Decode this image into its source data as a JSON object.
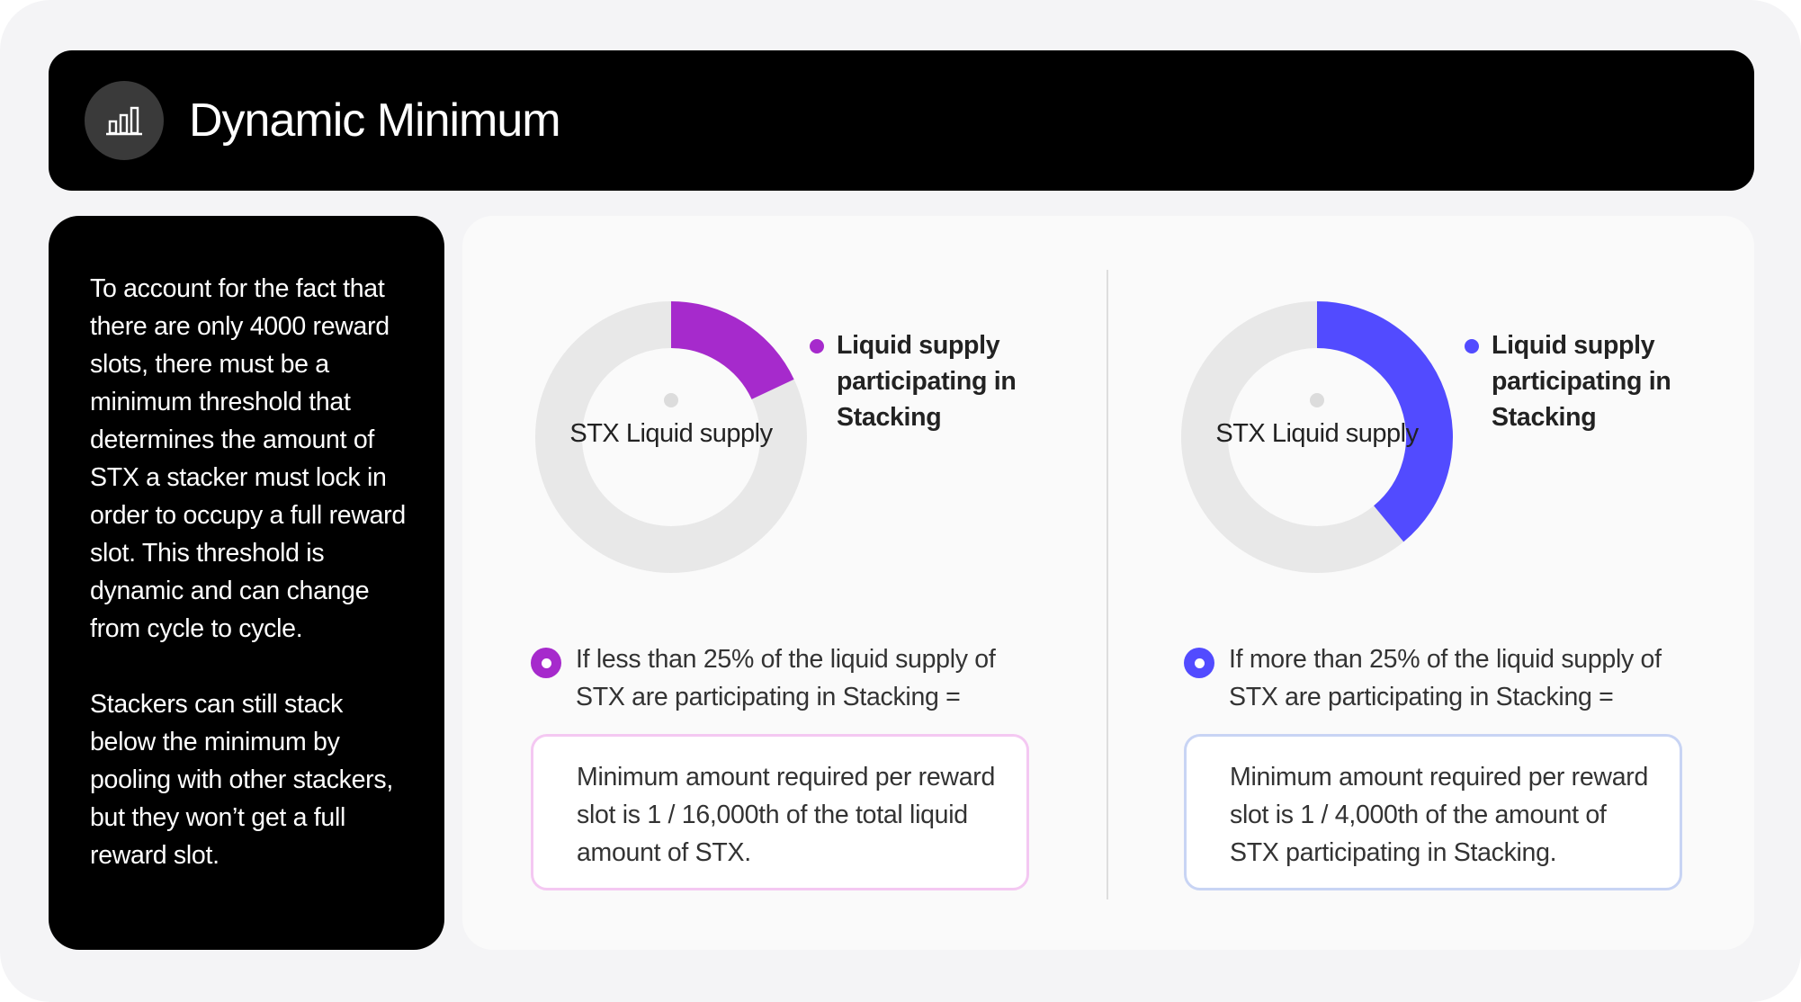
{
  "header": {
    "title": "Dynamic Minimum",
    "icon": "bar-chart-icon"
  },
  "sidebar": {
    "paragraphs": [
      "To account for the fact that there are only 4000 reward slots, there must be a minimum threshold that determines the amount of STX a stacker must lock in order to occupy a full reward slot. This threshold is dynamic and can change from cycle to cycle.",
      "Stackers can still stack below the minimum by pooling with other stackers, but they won’t get a full reward slot."
    ]
  },
  "colors": {
    "purple": "#a62acc",
    "blue": "#524bff",
    "ring_base": "#e8e8e8",
    "purple_border": "#f4c8f2",
    "blue_border": "#c8d4f4"
  },
  "panels": [
    {
      "donut": {
        "center_label": "STX Liquid supply",
        "participating_fraction": 0.18
      },
      "legend": "Liquid supply participating in Stacking",
      "condition": "If less than 25% of the liquid supply of STX are participating in Stacking =",
      "result": "Minimum amount required per reward slot is 1 / 16,000th of the total liquid amount of STX."
    },
    {
      "donut": {
        "center_label": "STX Liquid supply",
        "participating_fraction": 0.39
      },
      "legend": "Liquid supply participating in Stacking",
      "condition": "If more than 25% of the liquid supply of STX are participating in Stacking =",
      "result": "Minimum amount required per reward slot is 1 / 4,000th of the amount of STX participating in Stacking."
    }
  ]
}
